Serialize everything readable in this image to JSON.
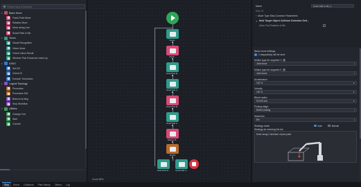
{
  "search": {
    "placeholder": "Please input a keyword"
  },
  "tree": [
    {
      "type": "cat",
      "label": "Basic Move",
      "color": "#c04b5a"
    },
    {
      "type": "item",
      "label": "Fixed-Point Move",
      "color": "#d84a76",
      "icon": "target-icon"
    },
    {
      "type": "item",
      "label": "Relative Move",
      "color": "#d84a76",
      "icon": "arrow-icon"
    },
    {
      "type": "item",
      "label": "Move along Line",
      "color": "#d84a76",
      "icon": "line-icon"
    },
    {
      "type": "item",
      "label": "Smart Path in Bin",
      "color": "#d84a76",
      "icon": "bin-icon"
    },
    {
      "type": "cat",
      "label": "Vision",
      "color": "#2f9c8a"
    },
    {
      "type": "item",
      "label": "Visual Recognition",
      "color": "#2f9c8a",
      "icon": "eye-icon"
    },
    {
      "type": "item",
      "label": "Vision Move",
      "color": "#2f9c8a",
      "icon": "camera-icon"
    },
    {
      "type": "item",
      "label": "Check Vision Result",
      "color": "#2f9c8a",
      "icon": "check-icon"
    },
    {
      "type": "item",
      "label": "Whether Pick Points Are Used Up",
      "color": "#2f9c8a",
      "icon": "question-icon"
    },
    {
      "type": "cat",
      "label": "DI/DO",
      "color": "#2f7ad1"
    },
    {
      "type": "item",
      "label": "Set DO",
      "color": "#2f7ad1",
      "icon": "output-icon"
    },
    {
      "type": "item",
      "label": "Check DI",
      "color": "#2f7ad1",
      "icon": "input-icon"
    },
    {
      "type": "item",
      "label": "Execute Tool Action",
      "color": "#2f7ad1",
      "icon": "tool-icon"
    },
    {
      "type": "cat",
      "label": "Logical Topology",
      "color": "#8a4fc4"
    },
    {
      "type": "item",
      "label": "Procedure",
      "color": "#b86b2e",
      "icon": "procedure-icon"
    },
    {
      "type": "item",
      "label": "Procedure Exit",
      "color": "#b86b2e",
      "icon": "exit-icon"
    },
    {
      "type": "item",
      "label": "Branch by Msg",
      "color": "#8a4fc4",
      "icon": "branch-icon"
    },
    {
      "type": "item",
      "label": "Stop Workflow",
      "color": "#8a4fc4",
      "icon": "stop-icon"
    },
    {
      "type": "cat",
      "label": "Utilities",
      "color": "#3a9c5a"
    },
    {
      "type": "item",
      "label": "Change Tool",
      "color": "#3a9c5a",
      "icon": "change-tool-icon"
    },
    {
      "type": "item",
      "label": "Wait",
      "color": "#3a9c5a",
      "icon": "wait-icon"
    },
    {
      "type": "item",
      "label": "Counter",
      "color": "#3a9c5a",
      "icon": "counter-icon"
    }
  ],
  "canvas": {
    "zoom": "Zoom 85%",
    "nodes": [
      {
        "label": "",
        "color": "#2fa55a"
      },
      {
        "label": "Visual...",
        "color": "#2f9c8a"
      },
      {
        "label": "Check...",
        "color": "#d84a76"
      },
      {
        "label": "Fixed-Point M...",
        "color": "#2f9c8a"
      },
      {
        "label": "Smart Path in...",
        "color": "#2f9c8a"
      },
      {
        "label": "Fixed-Point M...",
        "color": "#d84a76"
      },
      {
        "label": "Smart Path in...",
        "color": "#2f9c8a"
      },
      {
        "label": "Relative M...",
        "color": "#d84a76"
      },
      {
        "label": "Set DO",
        "color": "#b86b2e"
      },
      {
        "label": "Fixed-Point M...",
        "color": "#2f9c8a"
      },
      {
        "label": "Smart Path in...",
        "color": "#2f9c8a"
      },
      {
        "label": "",
        "color": "#d9343f"
      }
    ]
  },
  "props": {
    "name_label": "Name",
    "name_value": "Smart Path in Bin_1",
    "step_id_label": "Step ID",
    "step_id_value": "",
    "move_type_label": "Move Type Step Common Parameters",
    "hold_label": "Hold Target Object Collision Detection Sett...",
    "allow_label": "Allow Tool Rotation in Bin"
  },
  "basic": {
    "title": "Basic move settings",
    "waypoint_label": "2 waypoint(s) will be sent.",
    "seg1_label": "Motion type for segment 1",
    "seg1_value": "Joint move",
    "seg2_label": "Motion type for segment 2",
    "seg2_value": "Joint move",
    "accel_label": "Acceleration",
    "accel_value": "100 %",
    "vel_label": "Velocity",
    "vel_value": "100 %",
    "blend_label": "Blend radius",
    "blend_value": "50.000 mm",
    "picking_label": "Picking stage",
    "picking_value": "Before picking",
    "bin_label": "Select bin",
    "bin_value": "Bin",
    "strategy_label": "Strategy mode",
    "auto_label": "Auto",
    "manual_label": "Manual",
    "strategy_desc": "Strategy for entering the bin",
    "hint": "Enter along Z direction of pick point"
  },
  "tabs": [
    "Step",
    "Robot",
    "Collisions",
    "Plan History",
    "Others",
    "Log"
  ]
}
